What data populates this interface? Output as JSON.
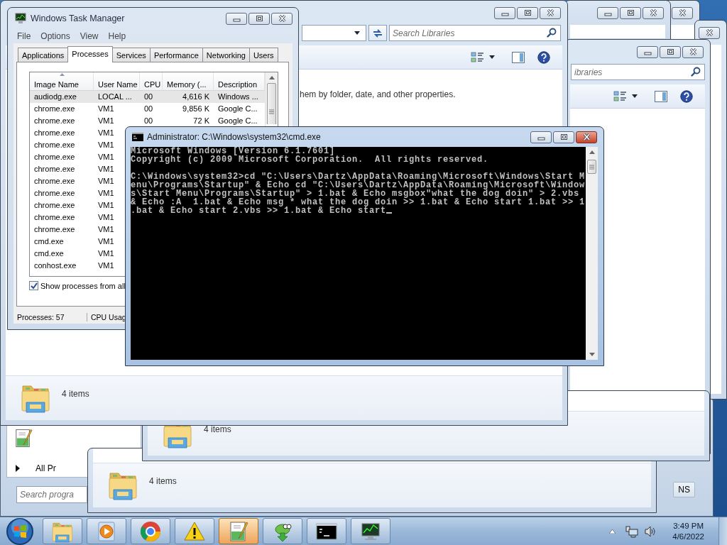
{
  "task_manager": {
    "title": "Windows Task Manager",
    "menu": [
      "File",
      "Options",
      "View",
      "Help"
    ],
    "tabs": [
      {
        "label": "Applications",
        "selected": false
      },
      {
        "label": "Processes",
        "selected": true
      },
      {
        "label": "Services",
        "selected": false
      },
      {
        "label": "Performance",
        "selected": false
      },
      {
        "label": "Networking",
        "selected": false
      },
      {
        "label": "Users",
        "selected": false
      }
    ],
    "columns": [
      {
        "label": "Image Name",
        "sorted": true
      },
      {
        "label": "User Name",
        "sorted": false
      },
      {
        "label": "CPU",
        "sorted": false
      },
      {
        "label": "Memory (...",
        "sorted": false
      },
      {
        "label": "Description",
        "sorted": false
      }
    ],
    "rows": [
      {
        "cells": [
          "audiodg.exe",
          "LOCAL ...",
          "00",
          "4,616 K",
          "Windows ..."
        ],
        "selected": true
      },
      {
        "cells": [
          "chrome.exe",
          "VM1",
          "00",
          "9,856 K",
          "Google C..."
        ],
        "selected": false
      },
      {
        "cells": [
          "chrome.exe",
          "VM1",
          "00",
          "72 K",
          "Google C..."
        ],
        "selected": false
      },
      {
        "cells": [
          "chrome.exe",
          "VM1"
        ],
        "selected": false
      },
      {
        "cells": [
          "chrome.exe",
          "VM1"
        ],
        "selected": false
      },
      {
        "cells": [
          "chrome.exe",
          "VM1"
        ],
        "selected": false
      },
      {
        "cells": [
          "chrome.exe",
          "VM1"
        ],
        "selected": false
      },
      {
        "cells": [
          "chrome.exe",
          "VM1"
        ],
        "selected": false
      },
      {
        "cells": [
          "chrome.exe",
          "VM1"
        ],
        "selected": false
      },
      {
        "cells": [
          "chrome.exe",
          "VM1"
        ],
        "selected": false
      },
      {
        "cells": [
          "chrome.exe",
          "VM1"
        ],
        "selected": false
      },
      {
        "cells": [
          "chrome.exe",
          "VM1"
        ],
        "selected": false
      },
      {
        "cells": [
          "cmd.exe",
          "VM1"
        ],
        "selected": false
      },
      {
        "cells": [
          "cmd.exe",
          "VM1"
        ],
        "selected": false
      },
      {
        "cells": [
          "conhost.exe",
          "VM1"
        ],
        "selected": false
      }
    ],
    "show_all_processes": {
      "label": "Show processes from all",
      "checked": true
    },
    "status": [
      "Processes: 57",
      "CPU Usag"
    ]
  },
  "cmd_window": {
    "title": "Administrator: C:\\Windows\\system32\\cmd.exe",
    "paragraphs": [
      [
        "Microsoft Windows [Version 6.1.7601]",
        "Copyright (c) 2009 Microsoft Corporation.  All rights reserved."
      ],
      [
        "C:\\Windows\\system32>cd \"C:\\Users\\Dartz\\AppData\\Roaming\\Microsoft\\Windows\\Start M",
        "enu\\Programs\\Startup\" & Echo cd \"C:\\Users\\Dartz\\AppData\\Roaming\\Microsoft\\Window",
        "s\\Start Menu\\Programs\\Startup\" > 1.bat & Echo msgbox\"what the dog doin\" > 2.vbs",
        "& Echo :A  1.bat & Echo msg * what the dog doin >> 1.bat & Echo start 1.bat >> 1",
        ".bat & Echo start 2.vbs >> 1.bat & Echo start"
      ]
    ]
  },
  "explorer_windows": [
    {
      "search_placeholder": "Search Libraries",
      "info_text": "hem by folder, date, and other properties.",
      "status": "4 items"
    },
    {
      "search_placeholder": "ibraries"
    },
    {
      "status": "4 items"
    },
    {
      "status": "4 items"
    }
  ],
  "start_menu": {
    "all_programs": "All Pr",
    "search_placeholder": "Search progra",
    "button_text": "NS"
  },
  "taskbar": {
    "buttons": [
      {
        "kind": "folder",
        "flashing": false
      },
      {
        "kind": "media",
        "flashing": false
      },
      {
        "kind": "browser",
        "flashing": false
      },
      {
        "kind": "warning",
        "flashing": false
      },
      {
        "kind": "editor",
        "flashing": true
      },
      {
        "kind": "lizard",
        "flashing": false
      },
      {
        "kind": "console",
        "flashing": false
      },
      {
        "kind": "monitor",
        "flashing": false
      }
    ],
    "clock": {
      "time": "3:49 PM",
      "date": "4/6/2022"
    }
  }
}
